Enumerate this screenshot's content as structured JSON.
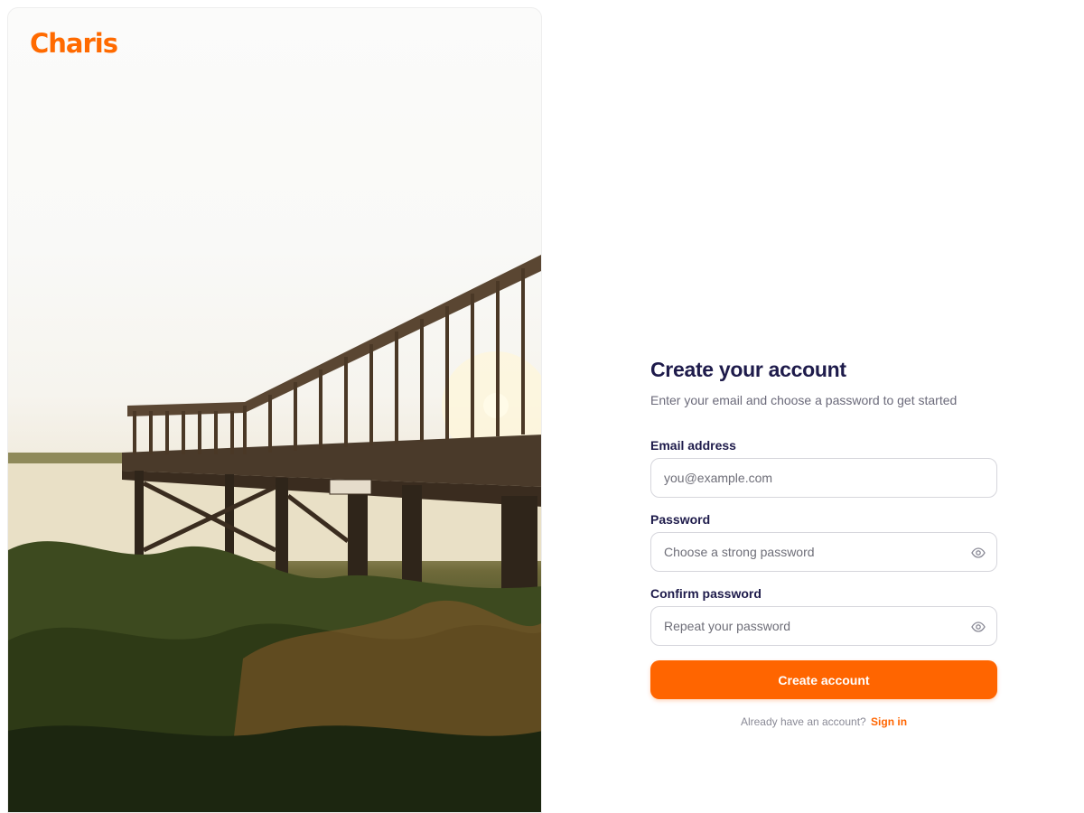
{
  "brand": {
    "name": "Charis",
    "color": "#ff6a00"
  },
  "hero_image": {
    "icon": "pier-sunset-photo"
  },
  "form": {
    "title": "Create your account",
    "subtitle": "Enter your email and choose a password to get started",
    "email": {
      "label": "Email address",
      "placeholder": "you@example.com",
      "value": ""
    },
    "password": {
      "label": "Password",
      "placeholder": "Choose a strong password",
      "value": "",
      "toggle_icon": "eye-icon"
    },
    "confirm": {
      "label": "Confirm password",
      "placeholder": "Repeat your password",
      "value": "",
      "toggle_icon": "eye-icon"
    },
    "submit_label": "Create account",
    "signin_prompt": "Already have an account?",
    "signin_link": "Sign in",
    "accent": "#ff6500"
  }
}
